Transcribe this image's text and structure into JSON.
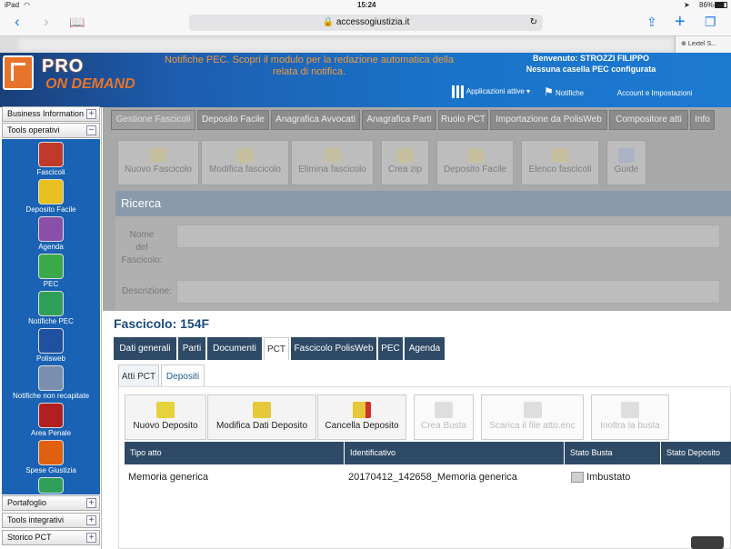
{
  "ios": {
    "device": "iPad",
    "time": "15:24",
    "battery": "86%"
  },
  "browser": {
    "url": "accessogiustizia.it",
    "tab_title": "Lextel S..."
  },
  "header": {
    "logo_top": "PRO",
    "logo_bottom": "ON DEMAND",
    "pec_notice": "Notifiche PEC. Scopri il modulo per la redazione automatica della relata di notifica.",
    "welcome_line1": "Benvenuto: STROZZI FILIPPO",
    "welcome_line2": "Nessuna casella PEC configurata",
    "apps_label": "Applicazioni attive",
    "notifications_label": "Notifiche",
    "account_label": "Account e Impostazioni"
  },
  "sidebar": {
    "sections_top": [
      {
        "label": "Business Information",
        "toggle": "+"
      },
      {
        "label": "Tools operativi",
        "toggle": "−"
      }
    ],
    "tools": [
      {
        "label": "Fascicoli",
        "color": "#c0392b"
      },
      {
        "label": "Deposito Facile",
        "color": "#e8c020"
      },
      {
        "label": "Agenda",
        "color": "#8a4fa8"
      },
      {
        "label": "PEC",
        "color": "#3aa94a"
      },
      {
        "label": "Notifiche PEC",
        "color": "#2fa05a"
      },
      {
        "label": "Polisweb",
        "color": "#2050a0"
      },
      {
        "label": "Notifiche non recapitate",
        "color": "#7a8fb0"
      },
      {
        "label": "Area Penale",
        "color": "#b02020"
      },
      {
        "label": "Spese Giustizia",
        "color": "#e06010"
      }
    ],
    "sections_bottom": [
      {
        "label": "Portafoglio",
        "toggle": "+"
      },
      {
        "label": "Tools integrativi",
        "toggle": "+"
      },
      {
        "label": "Storico PCT",
        "toggle": "+"
      }
    ]
  },
  "top_tabs": [
    "Gestione Fascicoli",
    "Deposito Facile",
    "Anagrafica Avvocati",
    "Anagrafica Parti",
    "Ruolo PCT",
    "Importazione da PolisWeb",
    "Compositore atti",
    "Info"
  ],
  "top_toolbar": [
    "Nuovo Fascicolo",
    "Modifica fascicolo",
    "Elimina fascicolo",
    "Crea zip",
    "Deposito Facile",
    "Elenco fascicoli",
    "Guide"
  ],
  "ricerca": {
    "title": "Ricerca",
    "name_label_1": "Nome",
    "name_label_2": "del",
    "name_label_3": "Fascicolo:",
    "desc_label": "Descrizione:"
  },
  "fascicolo": {
    "title": "Fascicolo: 154F",
    "tabs": [
      "Dati generali",
      "Parti",
      "Documenti",
      "PCT",
      "Fascicolo PolisWeb",
      "PEC",
      "Agenda"
    ],
    "subtabs": [
      "Atti PCT",
      "Depositi"
    ],
    "toolbar": [
      "Nuovo Deposito",
      "Modifica Dati Deposito",
      "Cancella Deposito",
      "Crea Busta",
      "Scarica il file atto.enc",
      "Inoltra la busta"
    ],
    "columns": [
      "Tipo atto",
      "Identificativo",
      "Stato Busta",
      "Stato Deposito"
    ],
    "rows": [
      {
        "tipo": "Memoria generica",
        "id": "20170412_142658_Memoria generica",
        "stato_busta": "Imbustato",
        "stato_deposito": ""
      }
    ]
  }
}
